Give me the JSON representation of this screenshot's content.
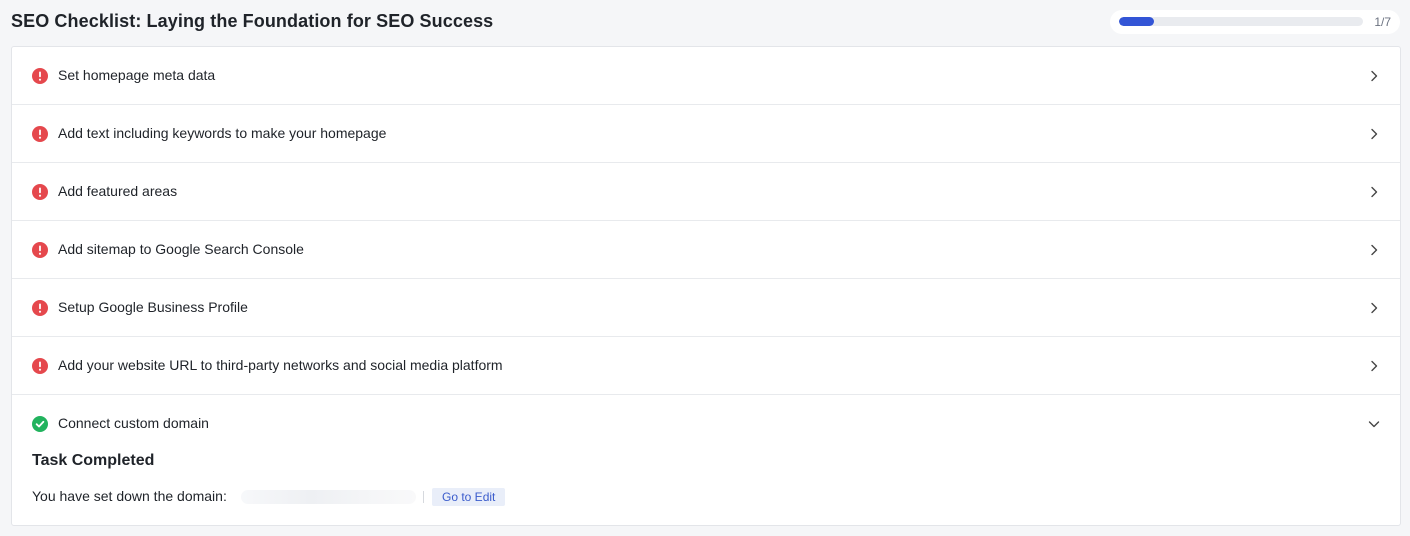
{
  "header": {
    "title": "SEO Checklist: Laying the Foundation for SEO Success",
    "progress": {
      "text": "1/7",
      "fraction": 0.1429,
      "color": "#3355d6"
    }
  },
  "colors": {
    "error": "#e5484d",
    "success": "#22b35e"
  },
  "checklist": {
    "items": [
      {
        "label": "Set homepage meta data",
        "status": "error",
        "icon": "alert-circle-icon",
        "action": "chevron-right-icon"
      },
      {
        "label": "Add text including keywords to make your homepage",
        "status": "error",
        "icon": "alert-circle-icon",
        "action": "chevron-right-icon"
      },
      {
        "label": "Add featured areas",
        "status": "error",
        "icon": "alert-circle-icon",
        "action": "chevron-right-icon"
      },
      {
        "label": "Add sitemap to Google Search Console",
        "status": "error",
        "icon": "alert-circle-icon",
        "action": "chevron-right-icon"
      },
      {
        "label": "Setup Google Business Profile",
        "status": "error",
        "icon": "alert-circle-icon",
        "action": "chevron-right-icon"
      },
      {
        "label": "Add your website URL to third-party networks and social media platform",
        "status": "error",
        "icon": "alert-circle-icon",
        "action": "chevron-right-icon"
      },
      {
        "label": "Connect custom domain",
        "status": "done",
        "icon": "check-circle-icon",
        "action": "chevron-down-icon"
      }
    ],
    "expanded": {
      "title": "Task Completed",
      "description": "You have set down the domain:",
      "edit_label": "Go to Edit"
    }
  }
}
